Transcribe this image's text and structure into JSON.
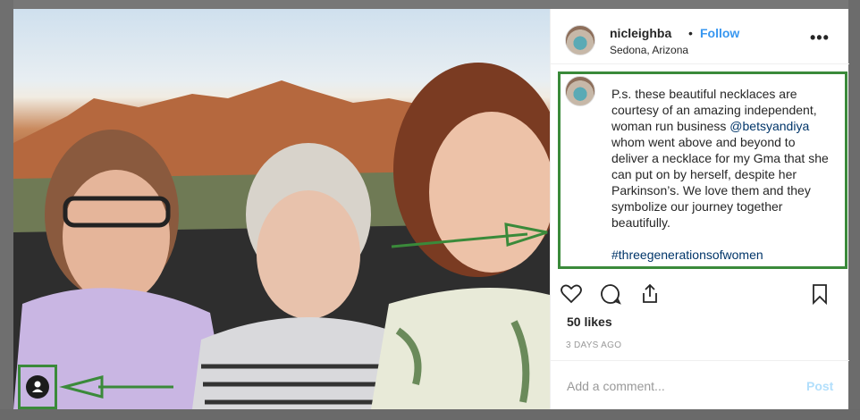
{
  "post": {
    "username": "nicleighba",
    "separator": "•",
    "follow_label": "Follow",
    "location": "Sedona, Arizona",
    "more_label": "•••",
    "caption": {
      "line1": "P.s. these beautiful necklaces are",
      "line2": "courtesy of an amazing independent,",
      "line3_prefix": "woman run business ",
      "mention": "@betsyandiya",
      "line4": "whom went above and beyond to",
      "line5": "deliver a necklace for my Gma that she",
      "line6": "can put on by herself, despite her",
      "line7": "Parkinson’s. We love them and they",
      "line8": "symbolize our journey together",
      "line9": "beautifully.",
      "hashtag": "#threegenerationsofwomen"
    },
    "likes": "50 likes",
    "date": "3 DAYS AGO",
    "comment_placeholder": "Add a comment...",
    "post_label": "Post"
  },
  "icons": {
    "like": "heart-icon",
    "comment": "comment-icon",
    "share": "share-icon",
    "save": "bookmark-icon",
    "tag": "user-tag-icon"
  },
  "colors": {
    "accent": "#3897f0",
    "annotation": "#3a8a3a",
    "link": "#003569"
  }
}
